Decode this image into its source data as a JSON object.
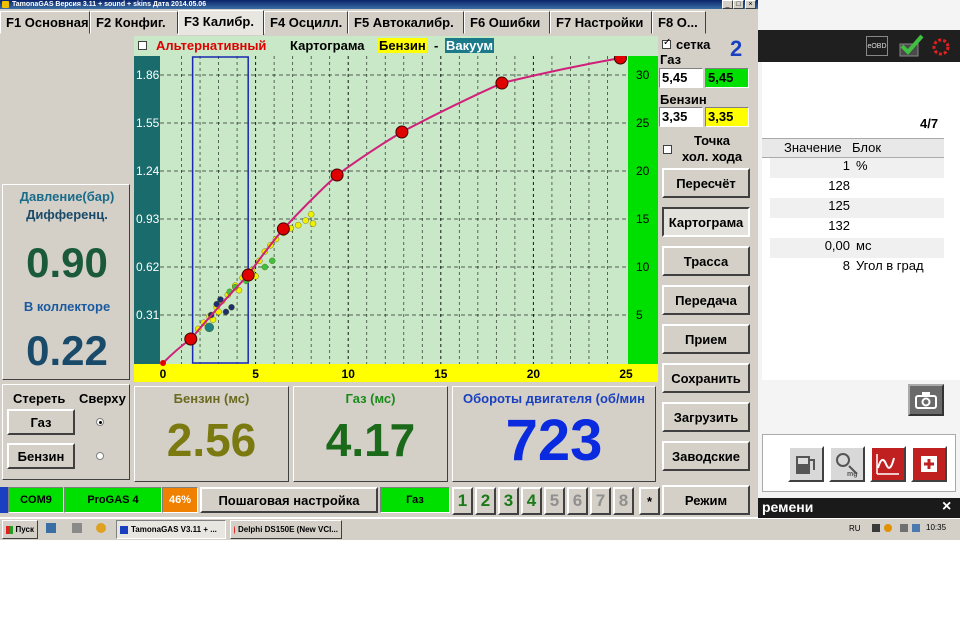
{
  "window": {
    "title": "TamonaGAS  Версия 3.11 + sound + skins  Дата 2014.05.06",
    "min_label": "_",
    "max_label": "□",
    "close_label": "×"
  },
  "tabs": [
    {
      "label": "F1 Основная"
    },
    {
      "label": "F2 Конфиг."
    },
    {
      "label": "F3 Калибр."
    },
    {
      "label": "F4 Осцилл."
    },
    {
      "label": "F5 Автокалибр."
    },
    {
      "label": "F6 Ошибки"
    },
    {
      "label": "F7 Настройки"
    },
    {
      "label": "F8 О..."
    }
  ],
  "pressure": {
    "title": "Давление(бар)",
    "diff_label": "Дифференц.",
    "diff_value": "0.90",
    "collector_label": "В коллекторе",
    "collector_value": "0.22"
  },
  "erase": {
    "erase_label": "Стереть",
    "top_label": "Сверху",
    "gas_button": "Газ",
    "petrol_button": "Бензин"
  },
  "chart_header": {
    "alt_label": "Альтернативный",
    "map_label": "Картограма",
    "petrol_label": "Бензин",
    "dash": "-",
    "vacuum_label": "Вакуум"
  },
  "chart_data": {
    "type": "line",
    "x_range": [
      0,
      25
    ],
    "y_range": [
      0,
      2.0
    ],
    "x_ticks": [
      0,
      5,
      10,
      15,
      20,
      25
    ],
    "y_ticks_left": [
      "1.86",
      "1.55",
      "1.24",
      "0.93",
      "0.62",
      "0.31"
    ],
    "y_ticks_left_values": [
      1.86,
      1.55,
      1.24,
      0.93,
      0.62,
      0.31
    ],
    "y_ticks_right": [
      "30",
      "25",
      "20",
      "15",
      "10",
      "5"
    ],
    "y_ticks_right_values": [
      30,
      25,
      20,
      15,
      10,
      5
    ],
    "right_range": [
      0,
      30
    ],
    "grid": true,
    "selection_x": [
      1.6,
      4.6
    ],
    "curve": {
      "color": "#d0207a",
      "node_color": "#e00000",
      "points": [
        [
          0.0,
          0.0
        ],
        [
          1.5,
          0.155
        ],
        [
          4.6,
          0.568
        ],
        [
          6.5,
          0.866
        ],
        [
          9.4,
          1.214
        ],
        [
          12.9,
          1.492
        ],
        [
          18.3,
          1.808
        ],
        [
          24.7,
          1.97
        ]
      ]
    },
    "scatter": [
      {
        "color": "#f0f000",
        "points": [
          [
            1.9,
            0.22
          ],
          [
            2.2,
            0.26
          ],
          [
            2.5,
            0.3
          ],
          [
            2.9,
            0.36
          ],
          [
            3.2,
            0.4
          ],
          [
            3.5,
            0.44
          ],
          [
            3.9,
            0.5
          ],
          [
            4.3,
            0.55
          ],
          [
            4.8,
            0.6
          ],
          [
            5.2,
            0.66
          ],
          [
            5.5,
            0.72
          ],
          [
            5.8,
            0.76
          ],
          [
            6.1,
            0.8
          ],
          [
            6.5,
            0.84
          ],
          [
            6.9,
            0.87
          ],
          [
            7.3,
            0.89
          ],
          [
            7.7,
            0.92
          ],
          [
            8.0,
            0.96
          ],
          [
            8.1,
            0.9
          ],
          [
            5.0,
            0.56
          ],
          [
            4.1,
            0.47
          ],
          [
            3.0,
            0.33
          ],
          [
            2.7,
            0.28
          ]
        ]
      },
      {
        "color": "#40c040",
        "points": [
          [
            3.6,
            0.46
          ],
          [
            3.9,
            0.49
          ],
          [
            5.5,
            0.62
          ],
          [
            5.9,
            0.66
          ],
          [
            4.5,
            0.53
          ]
        ]
      },
      {
        "color": "#1a3070",
        "points": [
          [
            2.9,
            0.38
          ],
          [
            3.1,
            0.41
          ],
          [
            3.4,
            0.33
          ],
          [
            3.7,
            0.36
          ],
          [
            2.6,
            0.31
          ]
        ]
      },
      {
        "color": "#208080",
        "points": [
          [
            2.5,
            0.23
          ]
        ]
      }
    ]
  },
  "right_col": {
    "grid_label": "сетка",
    "grid_number": "2",
    "gas_label": "Газ",
    "gas_value_1": "5,45",
    "gas_value_2": "5,45",
    "petrol_label": "Бензин",
    "petrol_value_1": "3,35",
    "petrol_value_2": "3,35",
    "idle_label_1": "Точка",
    "idle_label_2": "хол. хода",
    "buttons": [
      "Пересчёт",
      "Картограма",
      "Трасса",
      "Передача",
      "Прием",
      "Сохранить",
      "Загрузить",
      "Заводские"
    ]
  },
  "readouts": {
    "petrol_label": "Бензин (мс)",
    "petrol_value": "2.56",
    "gas_label": "Газ (мс)",
    "gas_value": "4.17",
    "rpm_label": "Обороты двигателя (об/мин",
    "rpm_value": "723"
  },
  "footer": {
    "com": "COM9",
    "ecu": "ProGAS 4",
    "percent": "46%",
    "step_button": "Пошаговая настройка",
    "fuel": "Газ",
    "steps": [
      "1",
      "2",
      "3",
      "4",
      "5",
      "6",
      "7",
      "8"
    ],
    "active_steps": 4,
    "star": "*",
    "mode_button": "Режим"
  },
  "delphi": {
    "page": "4/7",
    "col_value": "Значение",
    "col_unit": "Блок",
    "rows": [
      {
        "value": "1",
        "unit": "%"
      },
      {
        "value": "128",
        "unit": ""
      },
      {
        "value": "125",
        "unit": ""
      },
      {
        "value": "132",
        "unit": ""
      },
      {
        "value": "0,00",
        "unit": "мс"
      },
      {
        "value": "8",
        "unit": "Угол в град"
      }
    ],
    "bottom_text": "ремени",
    "obd_label": "eOBD",
    "close_label": "×"
  },
  "taskbar": {
    "start": "Пуск",
    "task1": "TamonaGAS  V3.11 + ...",
    "task2": "Delphi DS150E (New VCI...",
    "lang": "RU",
    "clock": "10:35"
  },
  "colors": {
    "face": "#d4d0c8",
    "plot_bg": "#c8e8c8",
    "left_axis": "#1a6b6b",
    "right_axis": "#00e000",
    "bottom_axis": "#ffff00",
    "selection": "#1a28b0"
  }
}
